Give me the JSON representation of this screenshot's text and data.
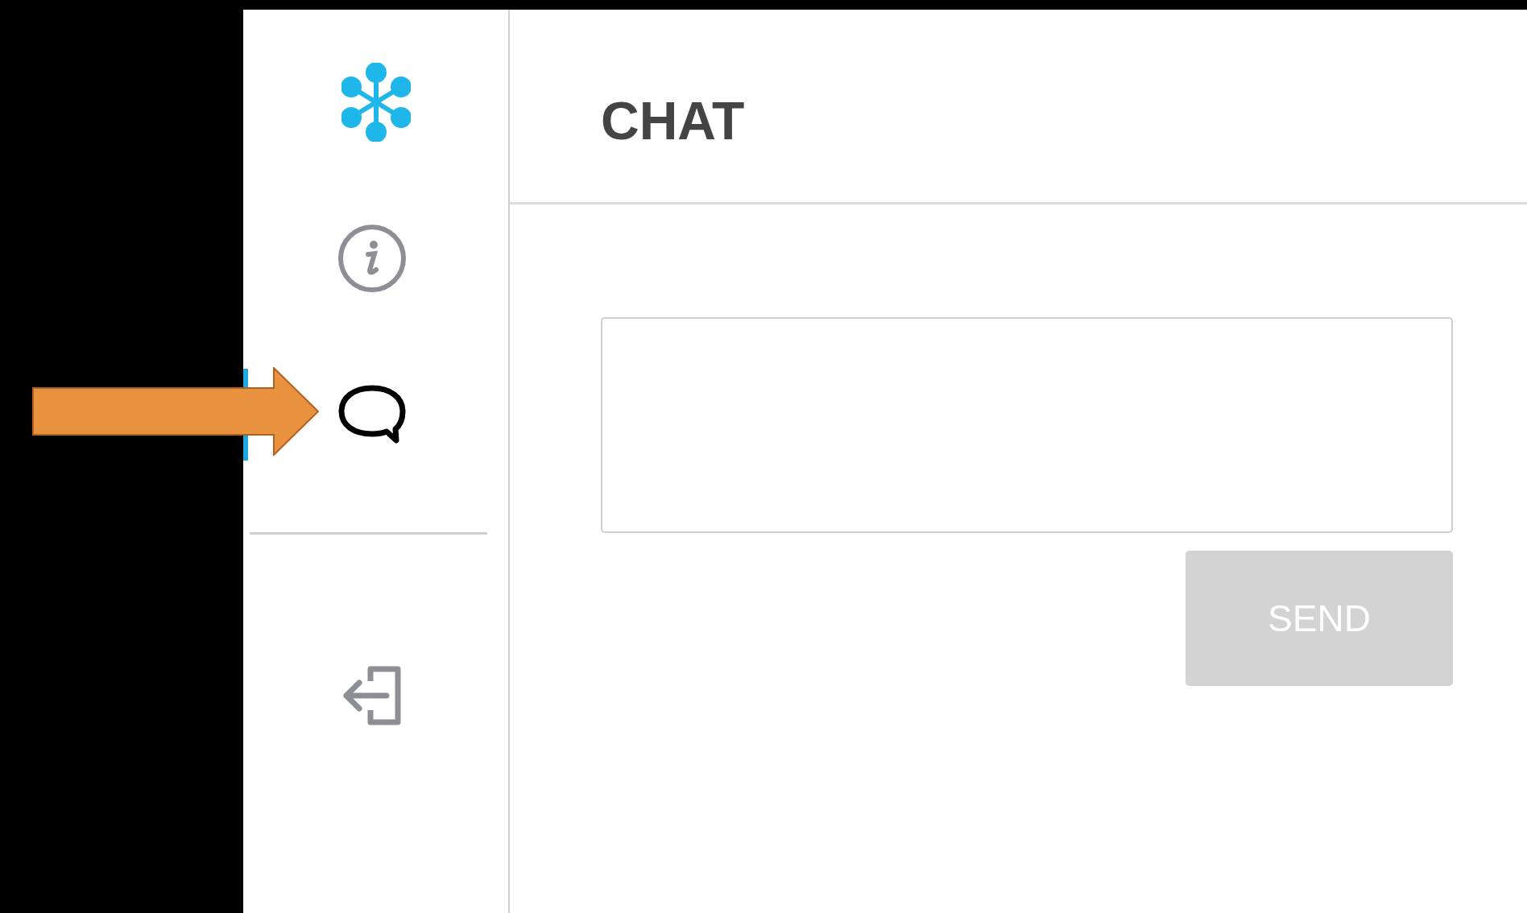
{
  "sidebar": {
    "items": [
      {
        "kind": "info",
        "selected": false
      },
      {
        "kind": "chat",
        "selected": true
      }
    ],
    "footer_items": [
      {
        "kind": "logout"
      }
    ]
  },
  "header": {
    "title": "CHAT"
  },
  "composer": {
    "send_button": {
      "label": "SEND",
      "disabled": true
    }
  }
}
